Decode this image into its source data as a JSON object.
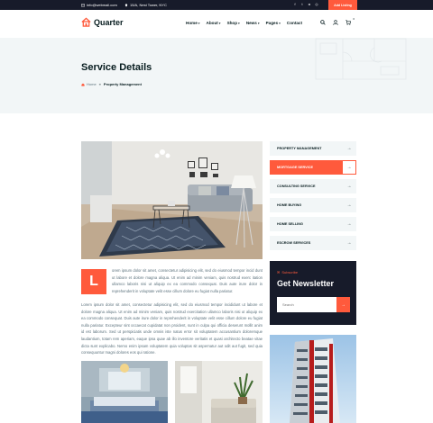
{
  "topbar": {
    "email": "info@webmail.com",
    "address": "15/A, Nest Tower, NYC",
    "social_icons": [
      "facebook-icon",
      "twitter-icon",
      "instagram-icon",
      "dribbble-icon"
    ],
    "add_listing": "Add Listing"
  },
  "header": {
    "logo_text": "Quarter",
    "nav": [
      {
        "label": "Home",
        "caret": "▾"
      },
      {
        "label": "About",
        "caret": "▾"
      },
      {
        "label": "Shop",
        "caret": "▾"
      },
      {
        "label": "News",
        "caret": "▾"
      },
      {
        "label": "Pages",
        "caret": "▾"
      },
      {
        "label": "Contact",
        "caret": ""
      }
    ],
    "icons": [
      "search-icon",
      "user-icon",
      "cart-icon"
    ],
    "cart_count": "0"
  },
  "banner": {
    "title": "Service Details",
    "breadcrumb_home": "Home",
    "breadcrumb_sep": "»",
    "breadcrumb_current": "Property Management"
  },
  "content": {
    "dropcap": "L",
    "paragraph1": "orem ipsum dolor sit amet, consectetur adipisicing elit, sed do eiusmod tempor incid dunt ut labore et dolore magna aliqua. Ut enim ad minim veniam, quis nostrud exerc itation ullamco laboris nisi ut aliquip ex ea commodo consequat. Duis aute irure dolor in reprehenderit in voluptate velit esse cillum dolore eu fugiat nulla pariatur.",
    "paragraph2": "Lorem ipsum dolor sit amet, consectetur adipisicing elit, sed do eiusmod tempor incididunt ut labore et dolore magna aliqua. Ut enim ad minim veniam, quis nostrud exercitation ullamco laboris nisi ut aliquip ex ea commodo consequat. Duis aute irure dolor in reprehenderit in voluptate velit esse cillum dolore eu fugiat nulla pariatur. Excepteur sint occaecat cupidatat non proident, sunt in culpa qui officia deserunt mollit anim id est laborum. Sed ut perspiciatis unde omnis iste natus error sit voluptatem accusantium doloremque laudantium, totam rem aperiam, eaque ipsa quae ab illo inventore veritatis et quasi architecto beatae vitae dicta sunt explicabo. Nemo enim ipsam voluptatem quia voluptas sit aspernatur aut odit aut fugit, sed quia consequuntur magni dolores eos qui ratione."
  },
  "sidebar": {
    "services": [
      {
        "label": "PROPERTY MANAGEMENT",
        "active": false
      },
      {
        "label": "MORTGAGE SERVICE",
        "active": true
      },
      {
        "label": "CONSULTING SERVICE",
        "active": false
      },
      {
        "label": "HOME BUYING",
        "active": false
      },
      {
        "label": "HOME SELLING",
        "active": false
      },
      {
        "label": "ESCROW SERVICES",
        "active": false
      }
    ],
    "arrow": "→",
    "newsletter": {
      "subtitle": "Subscribe",
      "title": "Get Newsletter",
      "placeholder": "Search",
      "button_icon": "arrow-right-icon"
    }
  },
  "colors": {
    "accent": "#ff5a3c",
    "dark": "#171b2a",
    "heading": "#071c1f",
    "light_bg": "#f2f6f7",
    "text": "#5c727d"
  }
}
